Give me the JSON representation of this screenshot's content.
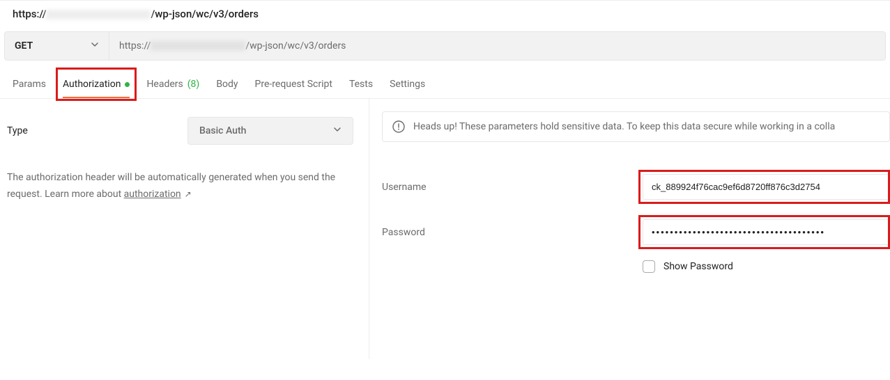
{
  "header": {
    "url_prefix": "https://",
    "url_path": "/wp-json/wc/v3/orders"
  },
  "request": {
    "method": "GET",
    "url_prefix": "https://",
    "url_path": "/wp-json/wc/v3/orders"
  },
  "tabs": {
    "params": "Params",
    "authorization": "Authorization",
    "headers": "Headers",
    "headers_count": "(8)",
    "body": "Body",
    "prerequest": "Pre-request Script",
    "tests": "Tests",
    "settings": "Settings"
  },
  "auth": {
    "type_label": "Type",
    "type_value": "Basic Auth",
    "description_line1": "The authorization header will be automatically generated when you send the request. Learn more about ",
    "description_link": "authorization",
    "notice": "Heads up! These parameters hold sensitive data. To keep this data secure while working in a colla",
    "username_label": "Username",
    "username_value": "ck_889924f76cac9ef6d8720ff876c3d2754",
    "password_label": "Password",
    "password_value": "••••••••••••••••••••••••••••••••••••••",
    "show_password": "Show Password"
  }
}
